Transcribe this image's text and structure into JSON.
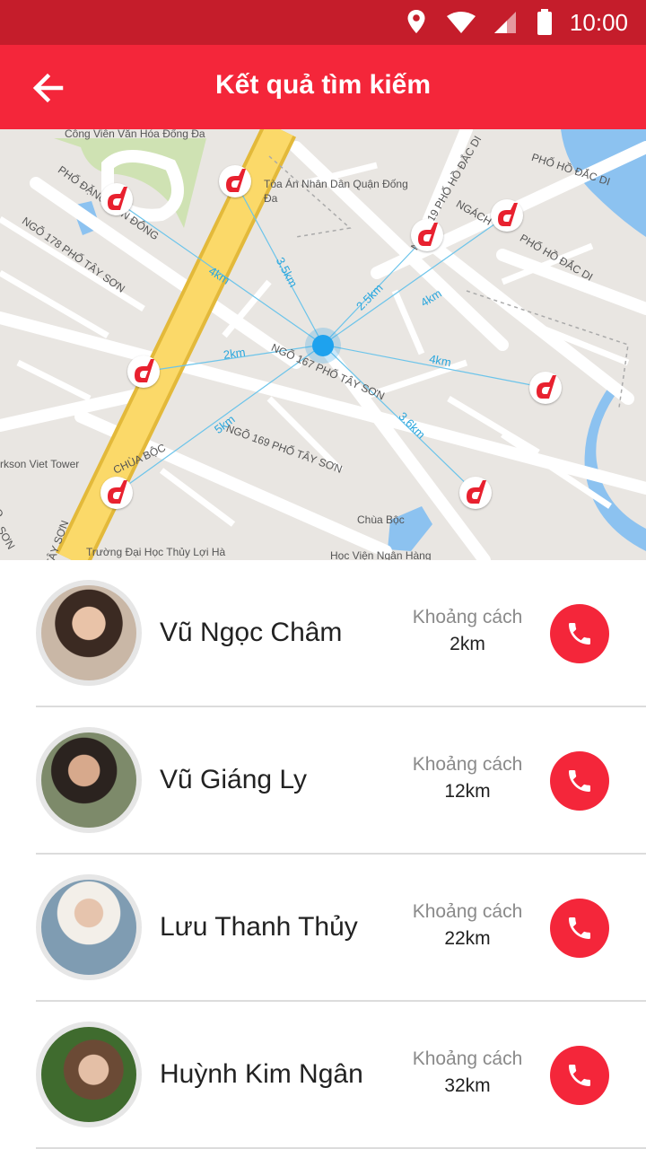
{
  "status_bar": {
    "time": "10:00"
  },
  "app_bar": {
    "title": "Kết quả tìm kiếm",
    "back_icon": "arrow-left-icon"
  },
  "colors": {
    "primary": "#f4263a",
    "status_bar": "#c51d2b",
    "my_location": "#1ea2ee",
    "distance_line": "#2aa6dd"
  },
  "map": {
    "street_labels": [
      "Công Viên Văn Hóa Đống Đa",
      "PHỐ ĐẶNG TIẾN ĐÔNG",
      "NGÕ 178 PHỐ TÂY SƠN",
      "Tòa Án Nhân Dân Quận Đống",
      "Đa",
      "NGÕ 119 PHỐ HỒ ĐẮC DI",
      "PHỐ HỒ ĐẮC DI",
      "NGÁCH",
      "PHỐ HỒ ĐẮC DI",
      "NGÕ 167 PHỐ TÂY SƠN",
      "NGÕ 169 PHỐ TÂY SƠN",
      "rkson Viet Tower",
      "CHÙA BỘC",
      "Chùa Bộc",
      "TÂY SƠN",
      "Trường Đại Học Thủy Lợi Hà",
      "Học Viện Ngân Hàng",
      "O",
      "SƠN"
    ],
    "distances": [
      "4km",
      "3.5km",
      "2.5km",
      "4km",
      "2km",
      "4km",
      "5km",
      "3.6km"
    ],
    "pin_icon": "d-logo-pin-icon",
    "my_location_icon": "my-location-dot-icon"
  },
  "list": {
    "distance_caption": "Khoảng cách",
    "call_icon": "phone-icon",
    "items": [
      {
        "name": "Vũ Ngọc Châm",
        "distance": "2km"
      },
      {
        "name": "Vũ Giáng Ly",
        "distance": "12km"
      },
      {
        "name": "Lưu Thanh Thủy",
        "distance": "22km"
      },
      {
        "name": "Huỳnh Kim Ngân",
        "distance": "32km"
      }
    ]
  }
}
